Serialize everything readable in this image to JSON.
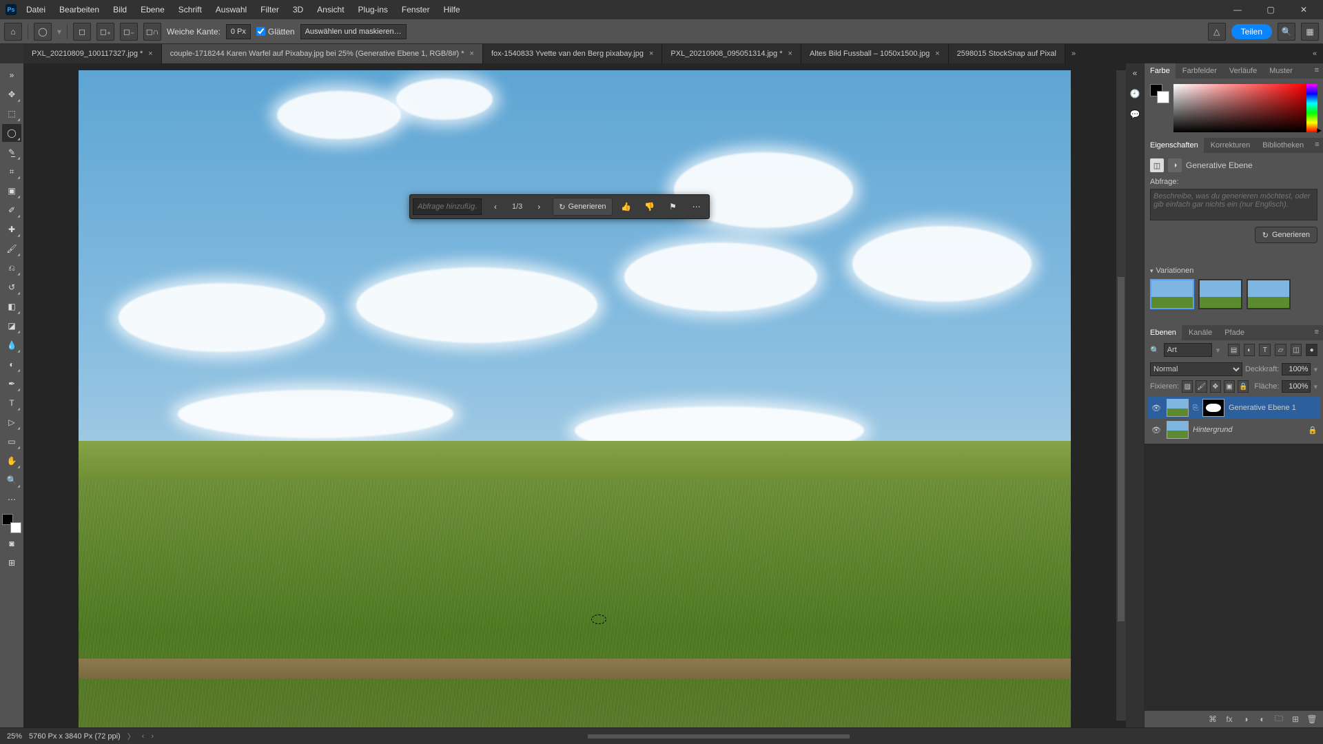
{
  "menu": {
    "items": [
      "Datei",
      "Bearbeiten",
      "Bild",
      "Ebene",
      "Schrift",
      "Auswahl",
      "Filter",
      "3D",
      "Ansicht",
      "Plug-ins",
      "Fenster",
      "Hilfe"
    ]
  },
  "options": {
    "feather_label": "Weiche Kante:",
    "feather_value": "0 Px",
    "antialias_label": "Glätten",
    "select_mask_label": "Auswählen und maskieren…",
    "share_label": "Teilen"
  },
  "tabs": [
    {
      "label": "PXL_20210809_100117327.jpg *"
    },
    {
      "label": "couple-1718244 Karen Warfel auf Pixabay.jpg bei 25% (Generative Ebene 1, RGB/8#) *"
    },
    {
      "label": "fox-1540833 Yvette van den Berg pixabay.jpg"
    },
    {
      "label": "PXL_20210908_095051314.jpg *"
    },
    {
      "label": "Altes Bild Fussball – 1050x1500.jpg"
    },
    {
      "label": "2598015 StockSnap auf Pixal"
    }
  ],
  "active_tab": 1,
  "contextbar": {
    "prompt_placeholder": "Abfrage hinzufüg…",
    "page": "1/3",
    "generate_label": "Generieren"
  },
  "panels": {
    "color_tabs": [
      "Farbe",
      "Farbfelder",
      "Verläufe",
      "Muster"
    ],
    "properties_tabs": [
      "Eigenschaften",
      "Korrekturen",
      "Bibliotheken"
    ],
    "properties": {
      "layer_type": "Generative Ebene",
      "prompt_label": "Abfrage:",
      "prompt_placeholder": "Beschreibe, was du generieren möchtest, oder gib einfach gar nichts ein (nur Englisch).",
      "generate_label": "Generieren",
      "variations_label": "Variationen"
    },
    "layers_tabs": [
      "Ebenen",
      "Kanäle",
      "Pfade"
    ],
    "layers": {
      "filter_label": "Art",
      "blend_mode": "Normal",
      "opacity_label": "Deckkraft:",
      "opacity_value": "100%",
      "lock_label": "Fixieren:",
      "fill_label": "Fläche:",
      "fill_value": "100%",
      "items": [
        {
          "name": "Generative Ebene 1",
          "locked": false,
          "has_mask": true
        },
        {
          "name": "Hintergrund",
          "locked": true,
          "has_mask": false
        }
      ]
    }
  },
  "status": {
    "zoom": "25%",
    "doc_info": "5760 Px x 3840 Px (72 ppi)"
  }
}
